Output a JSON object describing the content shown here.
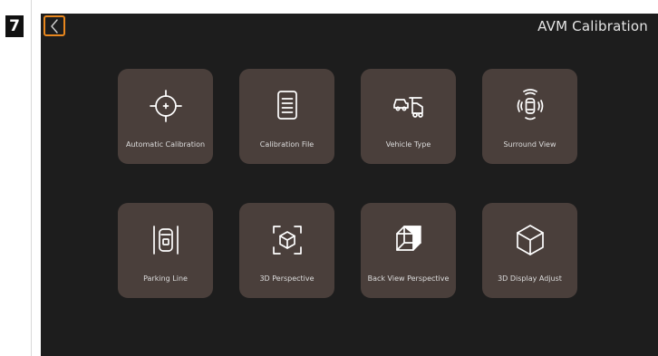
{
  "step": {
    "number": "7"
  },
  "header": {
    "title": "AVM Calibration",
    "accent_color": "#e8871e"
  },
  "tiles": [
    {
      "label": "Automatic Calibration",
      "icon": "crosshair-icon"
    },
    {
      "label": "Calibration File",
      "icon": "document-icon"
    },
    {
      "label": "Vehicle Type",
      "icon": "vehicle-type-icon"
    },
    {
      "label": "Surround View",
      "icon": "surround-view-icon"
    },
    {
      "label": "Parking Line",
      "icon": "parking-line-icon"
    },
    {
      "label": "3D Perspective",
      "icon": "cube-frame-icon"
    },
    {
      "label": "Back View Perspective",
      "icon": "back-view-cube-icon"
    },
    {
      "label": "3D Display Adjust",
      "icon": "cube-icon"
    }
  ]
}
